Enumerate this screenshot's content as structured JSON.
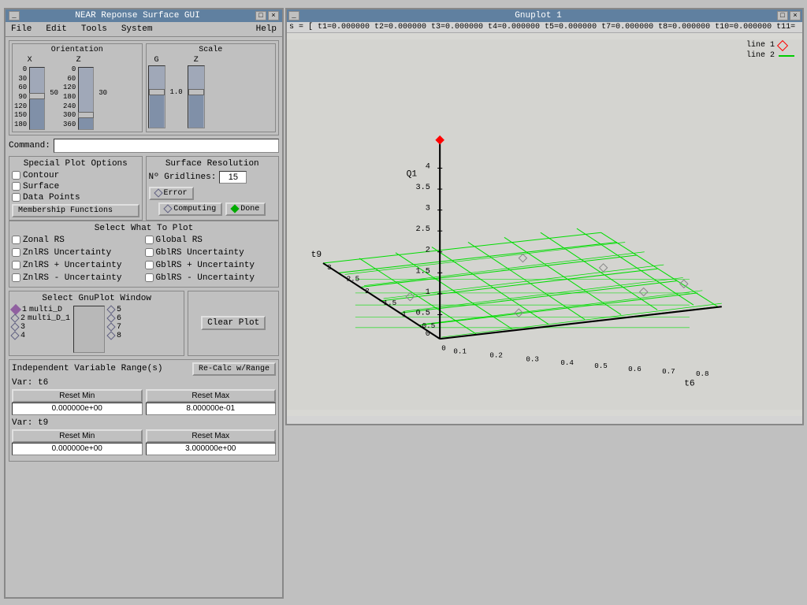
{
  "left_window": {
    "title": "NEAR Reponse Surface GUI",
    "menu": [
      "File",
      "Edit",
      "Tools",
      "System",
      "Help"
    ],
    "orientation": {
      "label": "Orientation",
      "axes": [
        "X",
        "Z"
      ],
      "x_ticks": [
        "0",
        "30",
        "60",
        "90",
        "120",
        "150",
        "180"
      ],
      "x_val": "50",
      "z_ticks": [
        "0",
        "60",
        "120",
        "180",
        "240",
        "300",
        "360"
      ],
      "z_val": "30"
    },
    "scale": {
      "label": "Scale",
      "axes": [
        "G",
        "Z"
      ],
      "g_ticks": [
        "",
        "",
        "",
        "",
        "",
        "",
        ""
      ],
      "g_val": "1.0",
      "z_ticks": [
        "",
        "",
        "",
        "",
        "",
        "",
        ""
      ],
      "z_val": "1.0"
    },
    "command": {
      "label": "Command:",
      "placeholder": ""
    },
    "special_plot": {
      "title": "Special Plot Options",
      "options": [
        {
          "label": "Contour",
          "checked": false
        },
        {
          "label": "Surface",
          "checked": false
        },
        {
          "label": "Data Points",
          "checked": false
        }
      ],
      "membership_btn": "Membership Functions"
    },
    "surface_res": {
      "title": "Surface Resolution",
      "gridlines_label": "Nº Gridlines:",
      "gridlines_value": "15",
      "error_btn": "Error",
      "computing_btn": "Computing",
      "done_btn": "Done"
    },
    "select_what": {
      "title": "Select What To Plot",
      "items": [
        {
          "label": "Zonal RS",
          "left": true
        },
        {
          "label": "Global RS",
          "left": false
        },
        {
          "label": "ZnlRS Uncertainty",
          "left": true
        },
        {
          "label": "GblRS Uncertainty",
          "left": false
        },
        {
          "label": "ZnlRS + Uncertainty",
          "left": true
        },
        {
          "label": "GblRS + Uncertainty",
          "left": false
        },
        {
          "label": "ZnlRS - Uncertainty",
          "left": true
        },
        {
          "label": "GblRS - Uncertainty",
          "left": false
        }
      ]
    },
    "gnuplot_section": {
      "title": "Select GnuPlot Window",
      "windows": [
        {
          "num": "1",
          "label": "multi_D",
          "active": true
        },
        {
          "num": "2",
          "label": "multi_D_1",
          "active": false
        },
        {
          "num": "3",
          "label": "",
          "active": false
        },
        {
          "num": "4",
          "label": "",
          "active": false
        }
      ],
      "right_windows": [
        "5",
        "6",
        "7",
        "8"
      ]
    },
    "clear_plot": {
      "label": "Clear Plot"
    },
    "indep_var": {
      "title": "Independent Variable Range(s)",
      "recalc_btn": "Re-Calc w/Range",
      "vars": [
        {
          "label": "Var: t6",
          "reset_min": "Reset Min",
          "reset_max": "Reset Max",
          "min_val": "0.000000e+00",
          "max_val": "8.000000e-01"
        },
        {
          "label": "Var: t9",
          "reset_min": "Reset Min",
          "reset_max": "Reset Max",
          "min_val": "0.000000e+00",
          "max_val": "3.000000e+00"
        }
      ]
    }
  },
  "gnuplot_window": {
    "title": "Gnuplot 1",
    "toolbar_text": "s = [ t1=0.000000 t2=0.000000 t3=0.000000 t4=0.000000 t5=0.000000 t7=0.000000 t8=0.000000 t10=0.000000 t11=",
    "legend": {
      "line1": "line 1",
      "line2": "line 2"
    },
    "axes": {
      "y_label": "Q1",
      "x_label": "t6",
      "z_label": "t9",
      "y_ticks": [
        "0.5",
        "1",
        "1.5",
        "2",
        "2.5",
        "3",
        "3.5",
        "4"
      ],
      "x_ticks": [
        "0",
        "0.1",
        "0.2",
        "0.3",
        "0.4",
        "0.5",
        "0.6",
        "0.7",
        "0.8"
      ],
      "z_ticks": [
        "0",
        "0.5",
        "1",
        "1.5",
        "2",
        "2.5",
        "3"
      ]
    }
  }
}
